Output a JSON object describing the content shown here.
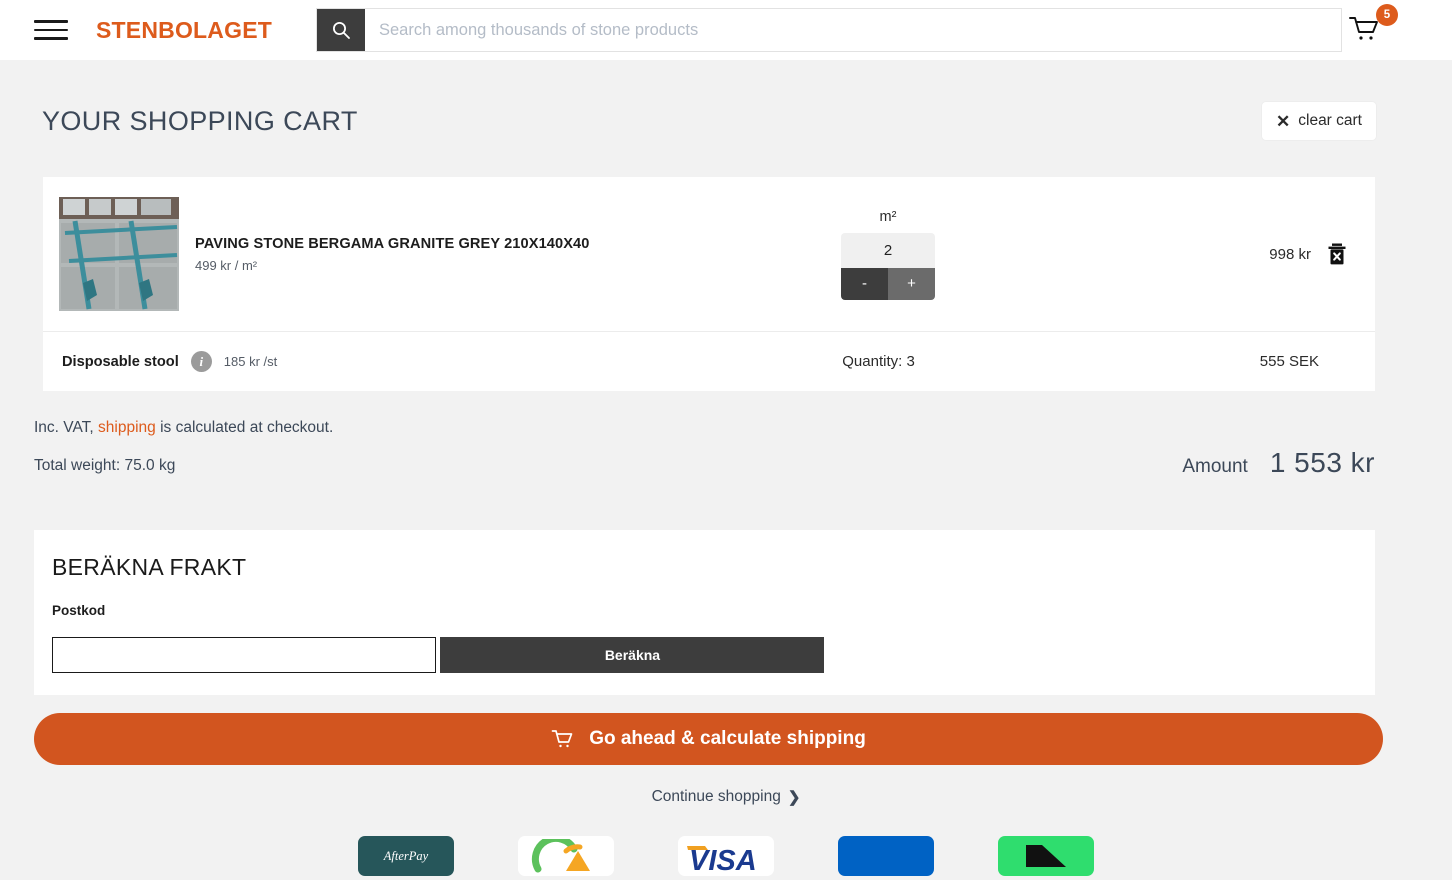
{
  "colors": {
    "brand_orange": "#dd5b1c",
    "cta_orange": "#d2551f",
    "dark": "#3d3d3d",
    "page_bg": "#f2f2f2",
    "text": "#3c4858"
  },
  "header": {
    "menu_icon": "hamburger-icon",
    "brand": "STENBOLAGET",
    "search": {
      "icon": "search-icon",
      "placeholder": "Search among thousands of stone products",
      "value": ""
    },
    "cart": {
      "icon": "shopping-cart-icon",
      "badge": "5"
    }
  },
  "cart": {
    "title": "YOUR SHOPPING CART",
    "clear_button": {
      "icon": "close-x-icon",
      "label": "clear cart"
    },
    "items": [
      {
        "image_alt": "granite-paving-stones-photo",
        "title": "PAVING STONE BERGAMA GRANITE GREY 210X140X40",
        "unit_price": "499 kr / m²",
        "unit": "m²",
        "quantity": "2",
        "decrement": "-",
        "increment": "+",
        "line_total": "998 kr",
        "remove_icon": "trash-delete-icon"
      }
    ],
    "addon": {
      "name": "Disposable stool",
      "info_icon": "info-circle-icon",
      "info_letter": "i",
      "unit_price": "185 kr /st",
      "quantity": "Quantity: 3",
      "total": "555 SEK"
    }
  },
  "summary": {
    "vat_prefix": "Inc. VAT,",
    "shipping_link": "shipping",
    "vat_suffix": "is calculated at checkout.",
    "total_weight": "Total weight: 75.0 kg",
    "amount_label": "Amount",
    "amount_value": "1 553 kr"
  },
  "shipping_calc": {
    "title": "BERÄKNA FRAKT",
    "postcode_label": "Postkod",
    "postcode_value": "",
    "postcode_placeholder": "",
    "button_label": "Beräkna"
  },
  "actions": {
    "cta_icon": "cart-outline-icon",
    "cta_label": "Go ahead & calculate shipping",
    "continue_label": "Continue shopping",
    "continue_icon": "chevron-right-icon"
  },
  "payments": [
    {
      "name": "afterpay-logo",
      "label": "AfterPay"
    },
    {
      "name": "klarna-swish-logo",
      "label": ""
    },
    {
      "name": "visa-logo",
      "label": "VISA"
    },
    {
      "name": "card-blue-logo",
      "label": ""
    },
    {
      "name": "swish-logo",
      "label": ""
    }
  ]
}
